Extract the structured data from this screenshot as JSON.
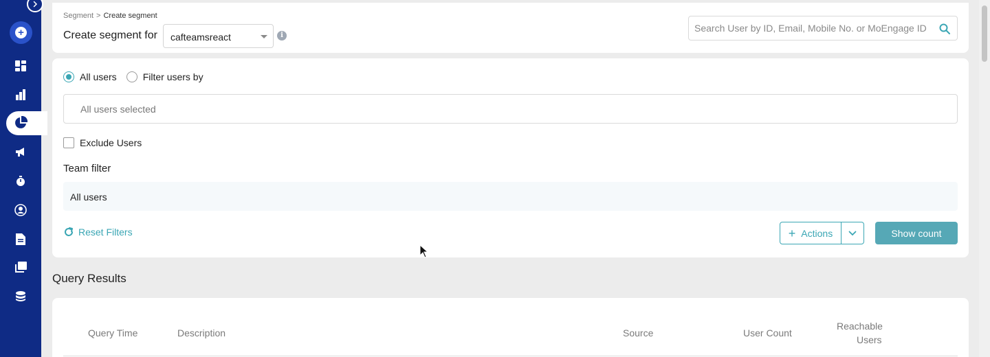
{
  "sidebar": {
    "toggle_icon": "chevron-right-circle-icon",
    "add_icon": "plus-circle-icon",
    "items": [
      {
        "name": "dashboard-icon",
        "active": false
      },
      {
        "name": "analytics-icon",
        "active": false
      },
      {
        "name": "segment-icon",
        "active": true
      },
      {
        "name": "campaign-icon",
        "active": false
      },
      {
        "name": "timer-icon",
        "active": false
      },
      {
        "name": "user-icon",
        "active": false
      },
      {
        "name": "document-icon",
        "active": false
      },
      {
        "name": "content-icon",
        "active": false
      },
      {
        "name": "database-icon",
        "active": false
      }
    ],
    "colors": {
      "background": "#0f2b85",
      "accent": "#2a52c9"
    }
  },
  "header": {
    "breadcrumb": {
      "parent": "Segment",
      "separator": ">",
      "current": "Create segment"
    },
    "title": "Create segment for",
    "app_select": {
      "value": "cafteamsreact"
    },
    "search": {
      "placeholder": "Search User by ID, Email, Mobile No. or MoEngage ID"
    }
  },
  "filters": {
    "radio_all_users": "All users",
    "radio_filter_by": "Filter users by",
    "selected": "all_users",
    "all_users_text": "All users selected",
    "exclude_users_label": "Exclude Users",
    "exclude_users_checked": false,
    "team_filter_title": "Team filter",
    "team_filter_value": "All users",
    "reset_label": "Reset Filters",
    "actions_label": "Actions",
    "show_count_label": "Show count",
    "accent_color": "#3aa6b4"
  },
  "query_results": {
    "title": "Query Results",
    "columns": [
      "Query Time",
      "Description",
      "Source",
      "User Count",
      "Reachable",
      "Users"
    ]
  }
}
